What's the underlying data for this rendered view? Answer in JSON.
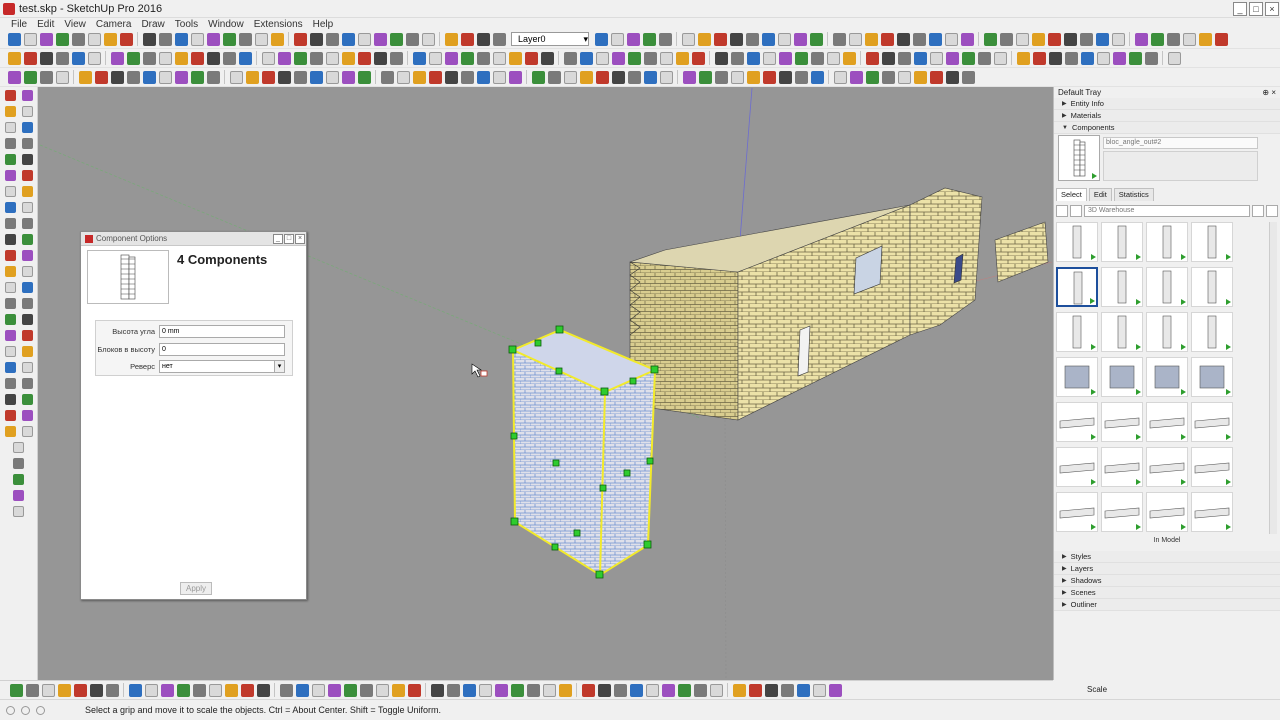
{
  "window": {
    "title": "test.skp - SketchUp Pro 2016"
  },
  "menu": [
    "File",
    "Edit",
    "View",
    "Camera",
    "Draw",
    "Tools",
    "Window",
    "Extensions",
    "Help"
  ],
  "toolbar": {
    "layer_value": "Layer0"
  },
  "dialog": {
    "title": "Component Options",
    "count_label": "4 Components",
    "fields": [
      {
        "label": "Высота угла",
        "value": "0 mm"
      },
      {
        "label": "Блоков в высоту",
        "value": "0"
      },
      {
        "label": "Реверс",
        "value": "нет"
      }
    ],
    "apply_label": "Apply"
  },
  "tray": {
    "title": "Default Tray",
    "sections_top": [
      "Entity Info",
      "Materials",
      "Components"
    ],
    "component_name": "bloc_angle_out#2",
    "tabs": [
      "Select",
      "Edit",
      "Statistics"
    ],
    "search_placeholder": "3D Warehouse",
    "in_model_label": "In Model",
    "sections_bottom": [
      "Styles",
      "Layers",
      "Shadows",
      "Scenes",
      "Outliner"
    ]
  },
  "measurements": {
    "label": "Scale"
  },
  "status": {
    "text": "Select a grip and move it to scale the objects. Ctrl = About Center. Shift = Toggle Uniform."
  },
  "colors": {
    "selection_yellow": "#f2ea2a",
    "grip_green": "#2ecc2e",
    "brick": "#ece2a8",
    "selected_blue": "#5c8fd6"
  }
}
